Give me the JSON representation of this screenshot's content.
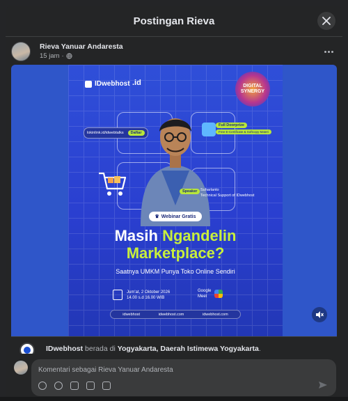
{
  "modal": {
    "title": "Postingan Rieva"
  },
  "post": {
    "author": "Rieva Yanuar Andaresta",
    "time": "15 jam",
    "separator": "·"
  },
  "poster": {
    "brand": "IDwebhost",
    "brand2": ".id",
    "badge": "DIGITAL SYNERGY",
    "link": "lokinlink.id/idwebtalks",
    "daftar": "Daftar",
    "fulldoor": "Full Doorprize",
    "perks": "Free E-Certificate & Softcopy Materi",
    "speaker_label": "Speaker",
    "speaker_name": "Suharlanto",
    "speaker_role": "Technical Support of IDwebhost",
    "webinar": "Webinar Gratis",
    "headline_a": "Masih ",
    "headline_b": "Ngandelin",
    "headline_c": "Marketplace?",
    "tagline": "Saatnya UMKM Punya Toko Online Sendiri",
    "date": "Jum'at, 2 Oktober 2026",
    "time": "14.00 s.d 16.00 WIB",
    "platform": "Google Meet",
    "social_1": "idwebhost",
    "social_2": "idwebhost.com",
    "social_3": "idwebhost.com"
  },
  "caption": {
    "page": "IDwebhost",
    "mid": " berada di ",
    "place": "Yogyakarta, Daerah Istimewa Yogyakarta",
    "end": "."
  },
  "comment": {
    "placeholder": "Komentari sebagai Rieva Yanuar Andaresta"
  },
  "colors": {
    "accent_lime": "#c8ef3c",
    "poster_blue": "#2a3fd0",
    "modal_bg": "#242526"
  }
}
